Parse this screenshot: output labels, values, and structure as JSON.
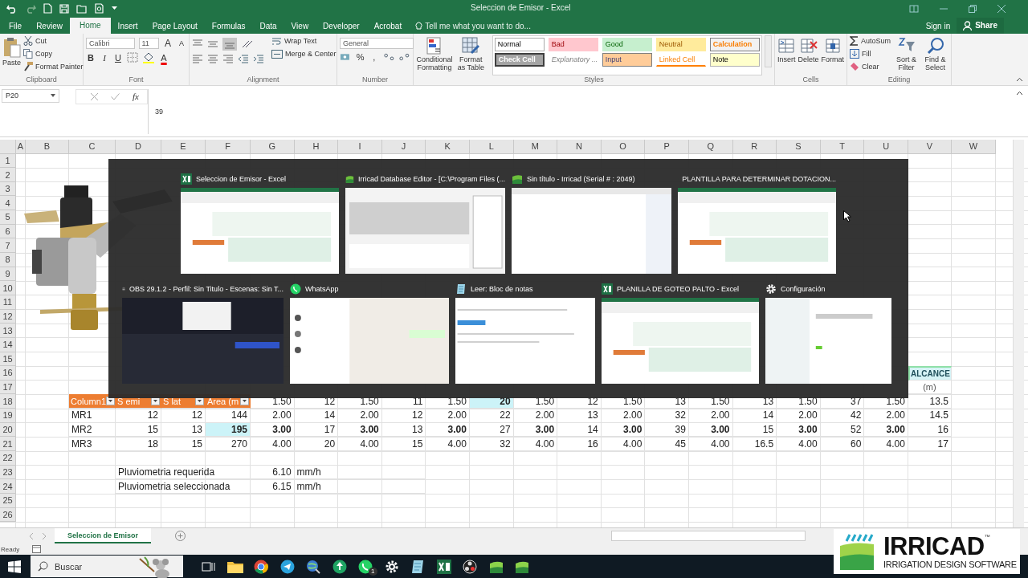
{
  "window": {
    "title": "Seleccion de Emisor - Excel"
  },
  "menu_tabs": [
    {
      "label": "File",
      "selected": false
    },
    {
      "label": "Review",
      "selected": false
    },
    {
      "label": "Home",
      "selected": true
    },
    {
      "label": "Insert",
      "selected": false
    },
    {
      "label": "Page Layout",
      "selected": false
    },
    {
      "label": "Formulas",
      "selected": false
    },
    {
      "label": "Data",
      "selected": false
    },
    {
      "label": "View",
      "selected": false
    },
    {
      "label": "Developer",
      "selected": false
    },
    {
      "label": "Acrobat",
      "selected": false
    }
  ],
  "tell_me": {
    "placeholder": "Tell me what you want to do..."
  },
  "account": {
    "sign_in": "Sign in",
    "share": "Share"
  },
  "ribbon": {
    "clipboard": {
      "paste": "Paste",
      "cut": "Cut",
      "copy": "Copy",
      "format_painter": "Format Painter",
      "label": "Clipboard"
    },
    "font": {
      "family": "Calibri",
      "size": "11",
      "grow": "A",
      "shrink": "A",
      "bold": "B",
      "italic": "I",
      "underline": "U",
      "font_color": "A",
      "label": "Font"
    },
    "alignment": {
      "wrap_text": "Wrap Text",
      "merge": "Merge & Center",
      "label": "Alignment"
    },
    "number": {
      "format": "General",
      "percent": "%",
      "comma": ",",
      "label": "Number"
    },
    "conditional_formatting": "Conditional Formatting",
    "format_as_table": "Format as Table",
    "styles": {
      "label": "Styles",
      "items": [
        {
          "label": "Normal",
          "kind": "normal"
        },
        {
          "label": "Bad",
          "kind": "bad"
        },
        {
          "label": "Good",
          "kind": "good"
        },
        {
          "label": "Neutral",
          "kind": "neutral"
        },
        {
          "label": "Calculation",
          "kind": "calculation"
        },
        {
          "label": "Check Cell",
          "kind": "check"
        },
        {
          "label": "Explanatory ...",
          "kind": "explanatory"
        },
        {
          "label": "Input",
          "kind": "input"
        },
        {
          "label": "Linked Cell",
          "kind": "linked"
        },
        {
          "label": "Note",
          "kind": "note"
        }
      ]
    },
    "cells": {
      "label": "Cells",
      "buttons": [
        {
          "label": "Insert",
          "kind": "insert"
        },
        {
          "label": "Delete",
          "kind": "delete"
        },
        {
          "label": "Format",
          "kind": "format"
        }
      ]
    },
    "editing": {
      "autosum": "AutoSum",
      "fill": "Fill",
      "clear": "Clear",
      "sort": "Sort & Filter",
      "find": "Find & Select",
      "label": "Editing"
    }
  },
  "formula_bar": {
    "name_box": "P20",
    "fx": "fx",
    "value": "39"
  },
  "sheet": {
    "columns": [
      "A",
      "B",
      "C",
      "D",
      "E",
      "F",
      "G",
      "H",
      "I",
      "J",
      "K",
      "L",
      "M",
      "N",
      "O",
      "P",
      "Q",
      "R",
      "S",
      "T",
      "U",
      "V",
      "W"
    ],
    "rows": [
      {
        "number": "1"
      },
      {
        "number": "2"
      },
      {
        "number": "3"
      },
      {
        "number": "4"
      },
      {
        "number": "5"
      },
      {
        "number": "6"
      },
      {
        "number": "7"
      },
      {
        "number": "8"
      },
      {
        "number": "9"
      },
      {
        "number": "10"
      },
      {
        "number": "11"
      },
      {
        "number": "12"
      },
      {
        "number": "13"
      },
      {
        "number": "14"
      },
      {
        "number": "15"
      },
      {
        "number": "16",
        "cells": {
          "V": {
            "text": "ALCANCE",
            "kind": "band"
          }
        }
      },
      {
        "number": "17",
        "cells": {
          "V": {
            "text": "(m)",
            "kind": "unit"
          }
        }
      },
      {
        "number": "18",
        "cells": {
          "C": {
            "text": "Column1",
            "kind": "filter_header"
          },
          "D": {
            "text": "S emi",
            "kind": "filter_header"
          },
          "E": {
            "text": "S lat",
            "kind": "filter_header"
          },
          "F": {
            "text": "Area (m",
            "kind": "filter_header"
          },
          "G": {
            "text": "1.50",
            "kind": "number"
          },
          "H": {
            "text": "12",
            "kind": "number"
          },
          "I": {
            "text": "1.50",
            "kind": "number"
          },
          "J": {
            "text": "11",
            "kind": "number"
          },
          "K": {
            "text": "1.50",
            "kind": "number"
          },
          "L": {
            "text": "20",
            "kind": "marked"
          },
          "M": {
            "text": "1.50",
            "kind": "number"
          },
          "N": {
            "text": "12",
            "kind": "number"
          },
          "O": {
            "text": "1.50",
            "kind": "number"
          },
          "P": {
            "text": "13",
            "kind": "number"
          },
          "Q": {
            "text": "1.50",
            "kind": "number"
          },
          "R": {
            "text": "13",
            "kind": "number"
          },
          "S": {
            "text": "1.50",
            "kind": "number"
          },
          "T": {
            "text": "37",
            "kind": "number"
          },
          "U": {
            "text": "1.50",
            "kind": "number"
          },
          "V": {
            "text": "13.5",
            "kind": "number"
          }
        }
      },
      {
        "number": "19",
        "cells": {
          "C": {
            "text": "MR1",
            "kind": "text"
          },
          "D": {
            "text": "12",
            "kind": "number"
          },
          "E": {
            "text": "12",
            "kind": "number"
          },
          "F": {
            "text": "144",
            "kind": "number"
          },
          "G": {
            "text": "2.00",
            "kind": "number"
          },
          "H": {
            "text": "14",
            "kind": "number"
          },
          "I": {
            "text": "2.00",
            "kind": "number"
          },
          "J": {
            "text": "12",
            "kind": "number"
          },
          "K": {
            "text": "2.00",
            "kind": "number"
          },
          "L": {
            "text": "22",
            "kind": "number"
          },
          "M": {
            "text": "2.00",
            "kind": "number"
          },
          "N": {
            "text": "13",
            "kind": "number"
          },
          "O": {
            "text": "2.00",
            "kind": "number"
          },
          "P": {
            "text": "32",
            "kind": "number"
          },
          "Q": {
            "text": "2.00",
            "kind": "number"
          },
          "R": {
            "text": "14",
            "kind": "number"
          },
          "S": {
            "text": "2.00",
            "kind": "number"
          },
          "T": {
            "text": "42",
            "kind": "number"
          },
          "U": {
            "text": "2.00",
            "kind": "number"
          },
          "V": {
            "text": "14.5",
            "kind": "number"
          }
        }
      },
      {
        "number": "20",
        "cells": {
          "C": {
            "text": "MR2",
            "kind": "text"
          },
          "D": {
            "text": "15",
            "kind": "number"
          },
          "E": {
            "text": "13",
            "kind": "number"
          },
          "F": {
            "text": "195",
            "kind": "marked"
          },
          "G": {
            "text": "3.00",
            "kind": "strong"
          },
          "H": {
            "text": "17",
            "kind": "number"
          },
          "I": {
            "text": "3.00",
            "kind": "strong"
          },
          "J": {
            "text": "13",
            "kind": "number"
          },
          "K": {
            "text": "3.00",
            "kind": "strong"
          },
          "L": {
            "text": "27",
            "kind": "number"
          },
          "M": {
            "text": "3.00",
            "kind": "strong"
          },
          "N": {
            "text": "14",
            "kind": "number"
          },
          "O": {
            "text": "3.00",
            "kind": "strong"
          },
          "P": {
            "text": "39",
            "kind": "number"
          },
          "Q": {
            "text": "3.00",
            "kind": "strong"
          },
          "R": {
            "text": "15",
            "kind": "number"
          },
          "S": {
            "text": "3.00",
            "kind": "strong"
          },
          "T": {
            "text": "52",
            "kind": "number"
          },
          "U": {
            "text": "3.00",
            "kind": "strong"
          },
          "V": {
            "text": "16",
            "kind": "number"
          }
        }
      },
      {
        "number": "21",
        "cells": {
          "C": {
            "text": "MR3",
            "kind": "text"
          },
          "D": {
            "text": "18",
            "kind": "number"
          },
          "E": {
            "text": "15",
            "kind": "number"
          },
          "F": {
            "text": "270",
            "kind": "number"
          },
          "G": {
            "text": "4.00",
            "kind": "number"
          },
          "H": {
            "text": "20",
            "kind": "number"
          },
          "I": {
            "text": "4.00",
            "kind": "number"
          },
          "J": {
            "text": "15",
            "kind": "number"
          },
          "K": {
            "text": "4.00",
            "kind": "number"
          },
          "L": {
            "text": "32",
            "kind": "number"
          },
          "M": {
            "text": "4.00",
            "kind": "number"
          },
          "N": {
            "text": "16",
            "kind": "number"
          },
          "O": {
            "text": "4.00",
            "kind": "number"
          },
          "P": {
            "text": "45",
            "kind": "number"
          },
          "Q": {
            "text": "4.00",
            "kind": "number"
          },
          "R": {
            "text": "16.5",
            "kind": "number"
          },
          "S": {
            "text": "4.00",
            "kind": "number"
          },
          "T": {
            "text": "60",
            "kind": "number"
          },
          "U": {
            "text": "4.00",
            "kind": "number"
          },
          "V": {
            "text": "17",
            "kind": "number"
          }
        }
      },
      {
        "number": "22"
      },
      {
        "number": "23",
        "cells": {
          "D": {
            "text": "Pluviometria requerida",
            "kind": "text"
          },
          "G": {
            "text": "6.10",
            "kind": "number"
          },
          "H": {
            "text": "mm/h",
            "kind": "text"
          }
        }
      },
      {
        "number": "24",
        "cells": {
          "D": {
            "text": "Pluviometria seleccionada",
            "kind": "text"
          },
          "G": {
            "text": "6.15",
            "kind": "number"
          },
          "H": {
            "text": "mm/h",
            "kind": "text"
          }
        }
      },
      {
        "number": "25"
      },
      {
        "number": "26"
      }
    ]
  },
  "task_switcher": {
    "rows": [
      {
        "windows": [
          {
            "title": "Seleccion de Emisor - Excel",
            "kind": "excel"
          },
          {
            "title": "Irricad Database Editor - [C:\\Program Files (...",
            "kind": "irricad_db"
          },
          {
            "title": "Sin título - Irricad (Serial # : 2049)",
            "kind": "irricad"
          },
          {
            "title": "PLANTILLA PARA DETERMINAR DOTACION...",
            "kind": "excel"
          }
        ]
      },
      {
        "windows": [
          {
            "title": "OBS 29.1.2 - Perfil: Sin Titulo - Escenas: Sin T...",
            "kind": "obs"
          },
          {
            "title": "WhatsApp",
            "kind": "whatsapp"
          },
          {
            "title": "Leer: Bloc de notas",
            "kind": "notepad"
          },
          {
            "title": "PLANILLA DE GOTEO  PALTO - Excel",
            "kind": "excel"
          },
          {
            "title": "Configuración",
            "kind": "settings"
          }
        ]
      }
    ]
  },
  "sheet_tabs": [
    {
      "label": "Seleccion de Emisor",
      "selected": true
    }
  ],
  "status_bar": {
    "text": "Ready"
  },
  "taskbar": {
    "search": {
      "placeholder": "Buscar"
    },
    "apps": [
      {
        "kind": "task_view"
      },
      {
        "kind": "explorer"
      },
      {
        "kind": "chrome"
      },
      {
        "kind": "telegram"
      },
      {
        "kind": "globe"
      },
      {
        "kind": "drive"
      },
      {
        "kind": "whatsapp",
        "badge": "1"
      },
      {
        "kind": "settings"
      },
      {
        "kind": "notepad"
      },
      {
        "kind": "excel"
      },
      {
        "kind": "obs"
      },
      {
        "kind": "irricad"
      },
      {
        "kind": "irricad"
      }
    ]
  },
  "logo": {
    "name": "IRRICAD",
    "trademark": "™",
    "tagline": "IRRIGATION DESIGN SOFTWARE"
  }
}
